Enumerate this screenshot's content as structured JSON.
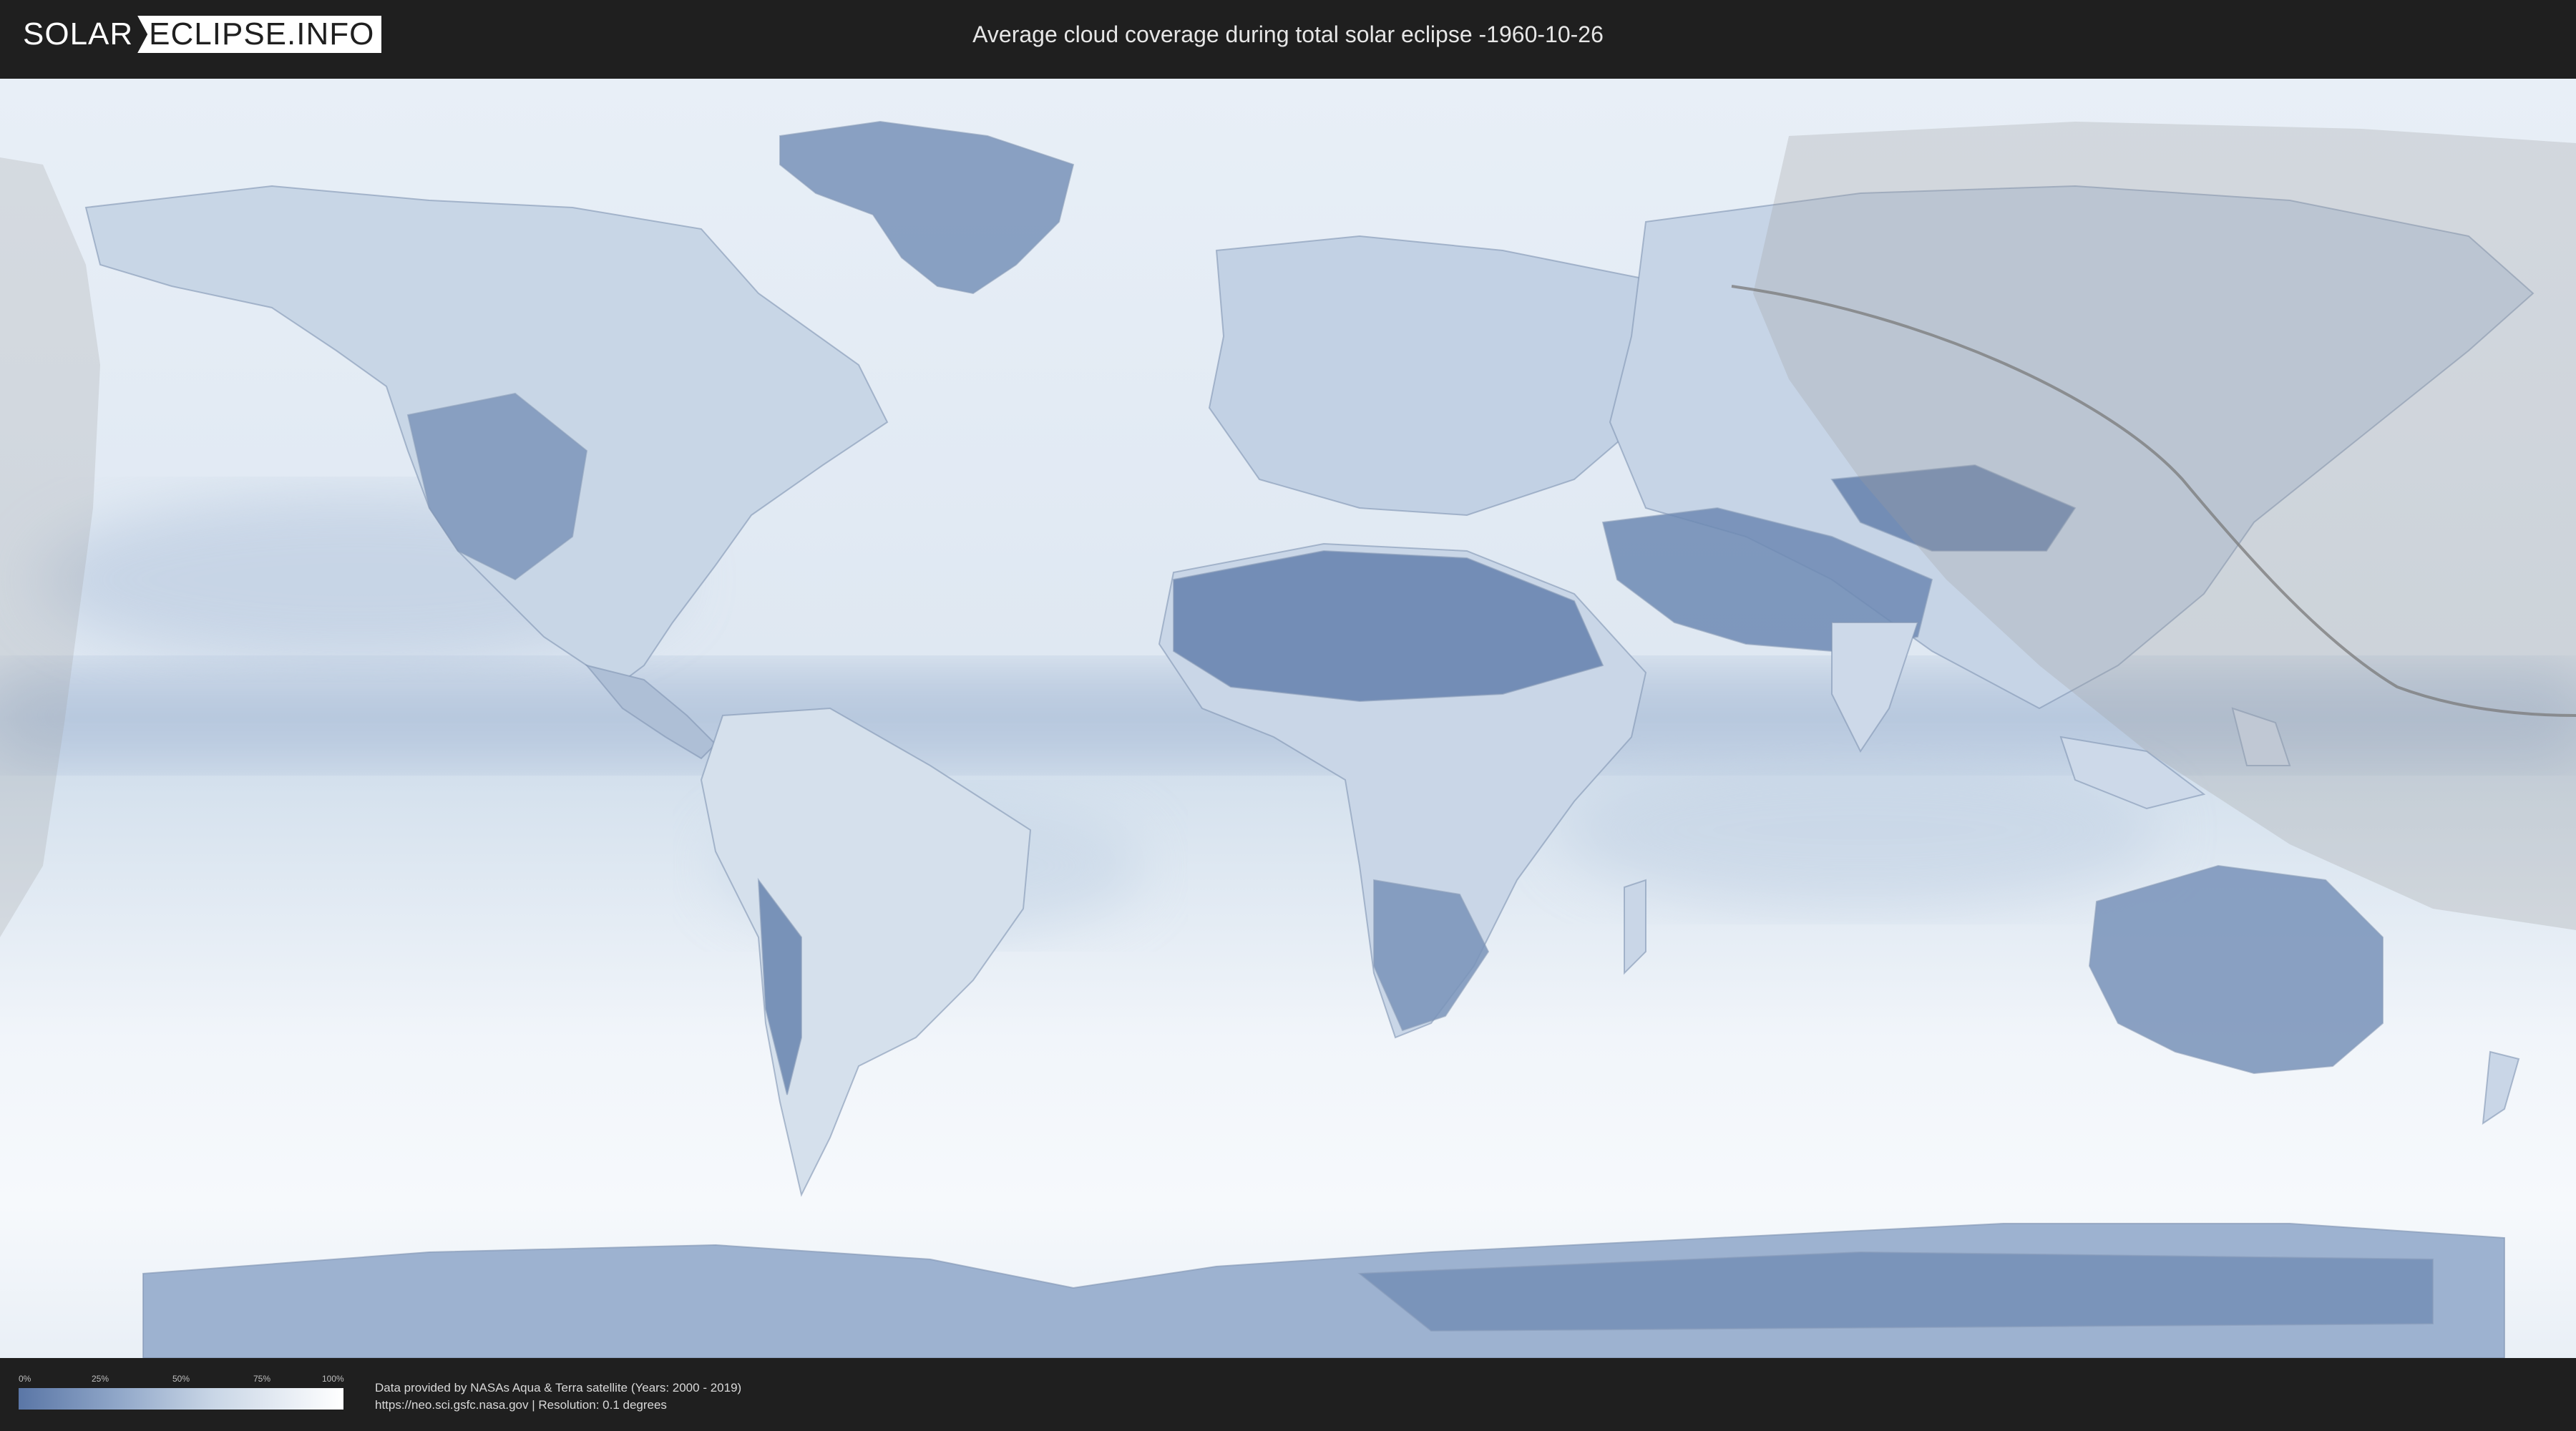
{
  "header": {
    "logo_part1": "SOLAR",
    "logo_part2": "ECLIPSE.INFO",
    "title": "Average cloud coverage during total solar eclipse -1960-10-26"
  },
  "legend": {
    "ticks": [
      "0%",
      "25%",
      "50%",
      "75%",
      "100%"
    ],
    "colors": {
      "low": "#5a76a6",
      "high": "#ffffff"
    }
  },
  "credits": {
    "line1": "Data provided by NASAs Aqua & Terra satellite (Years: 2000 - 2019)",
    "line2": "https://neo.sci.gsfc.nasa.gov | Resolution: 0.1 degrees"
  },
  "map": {
    "ocean_color": "#eef3f8",
    "cloud_dark_color": "#5f7ca9",
    "eclipse_shadow_color": "#9e9e9e",
    "icons": [
      "world-map",
      "eclipse-visibility-zone",
      "eclipse-central-path"
    ]
  }
}
